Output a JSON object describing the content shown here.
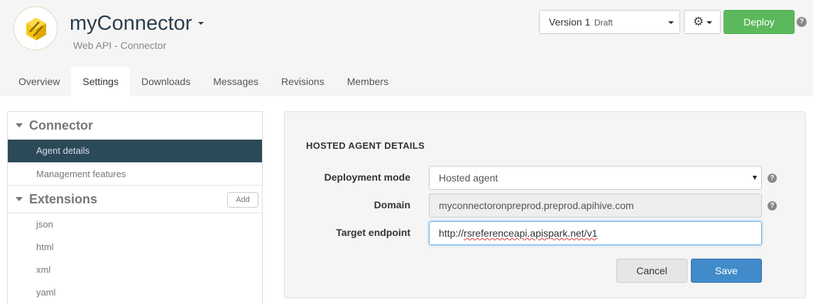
{
  "app": {
    "title": "myConnector",
    "subtitle": "Web API - Connector",
    "logo_icon": "hexagon-cube-icon",
    "brand_color": "#f0b400"
  },
  "header": {
    "version_label": "Version 1",
    "version_status": "Draft",
    "settings_icon": "gear-icon",
    "deploy_label": "Deploy",
    "help_icon": "question-icon",
    "deploy_color": "#5cb85c"
  },
  "tabs": [
    {
      "label": "Overview",
      "active": false
    },
    {
      "label": "Settings",
      "active": true
    },
    {
      "label": "Downloads",
      "active": false
    },
    {
      "label": "Messages",
      "active": false
    },
    {
      "label": "Revisions",
      "active": false
    },
    {
      "label": "Members",
      "active": false
    }
  ],
  "sidebar": {
    "connector_section": {
      "label": "Connector",
      "items": [
        {
          "label": "Agent details",
          "active": true
        },
        {
          "label": "Management features",
          "active": false
        }
      ]
    },
    "extensions_section": {
      "label": "Extensions",
      "add_label": "Add",
      "items": [
        "json",
        "html",
        "xml",
        "yaml"
      ]
    },
    "active_color": "#2b4a58"
  },
  "form": {
    "heading": "HOSTED AGENT DETAILS",
    "deployment_mode": {
      "label": "Deployment mode",
      "value": "Hosted agent"
    },
    "domain": {
      "label": "Domain",
      "value": "myconnectoronpreprod.preprod.apihive.com"
    },
    "target_endpoint": {
      "label": "Target endpoint",
      "value_prefix": "http://",
      "value_rest": "rsreferenceapi.apispark.net/v1"
    },
    "cancel_label": "Cancel",
    "save_label": "Save",
    "save_color": "#428bca"
  }
}
